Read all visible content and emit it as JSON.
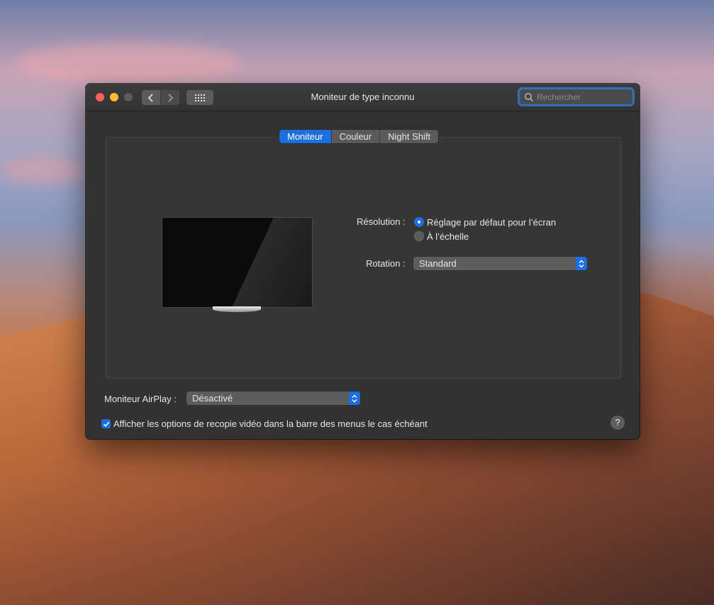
{
  "window": {
    "title": "Moniteur de type inconnu",
    "search_placeholder": "Rechercher"
  },
  "icons": {
    "back": "chevron-left-icon",
    "forward": "chevron-right-icon",
    "grid": "grid-icon",
    "search": "magnifier-icon",
    "popup_arrows": "up-down-chevron-icon",
    "checkmark": "checkmark-icon"
  },
  "tabs": [
    {
      "label": "Moniteur",
      "active": true
    },
    {
      "label": "Couleur",
      "active": false
    },
    {
      "label": "Night Shift",
      "active": false
    }
  ],
  "resolution": {
    "label": "Résolution :",
    "options": [
      {
        "label": "Réglage par défaut pour l’écran",
        "selected": true
      },
      {
        "label": "À l’échelle",
        "selected": false
      }
    ]
  },
  "rotation": {
    "label": "Rotation :",
    "value": "Standard"
  },
  "airplay": {
    "label": "Moniteur AirPlay :",
    "value": "Désactivé"
  },
  "mirroring_option": {
    "label": "Afficher les options de recopie vidéo dans la barre des menus le cas échéant",
    "checked": true
  },
  "help": {
    "label": "?"
  },
  "colors": {
    "accent": "#1d6fe0",
    "window_bg": "#323232",
    "close": "#ff5f57",
    "minimize": "#febc2e",
    "zoom_disabled": "#5c5c5c"
  }
}
